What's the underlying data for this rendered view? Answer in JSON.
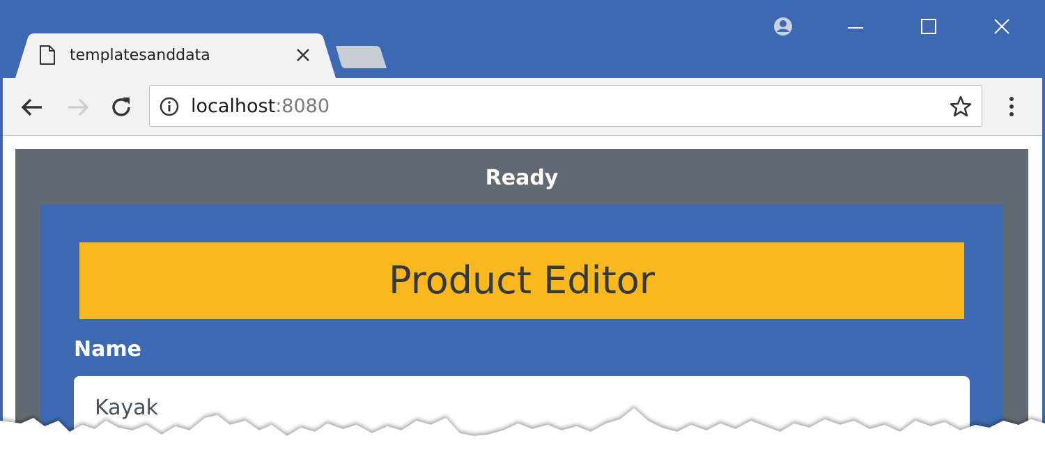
{
  "browser": {
    "tab": {
      "title": "templatesanddata",
      "close_icon": "close-icon",
      "file_icon": "page-icon"
    },
    "window_controls": [
      "account-icon",
      "minimize-icon",
      "maximize-icon",
      "close-icon"
    ],
    "address_bar": {
      "host": "localhost",
      "port": ":8080"
    },
    "colors": {
      "frame": "#3d69b2",
      "toolbar": "#f2f2f2"
    }
  },
  "page": {
    "status": "Ready",
    "editor": {
      "title": "Product Editor",
      "fields": [
        {
          "label": "Name",
          "value": "Kayak"
        }
      ]
    },
    "colors": {
      "status_panel": "#616a72",
      "editor_panel": "#3d69b2",
      "header": "#f8b81e"
    }
  }
}
